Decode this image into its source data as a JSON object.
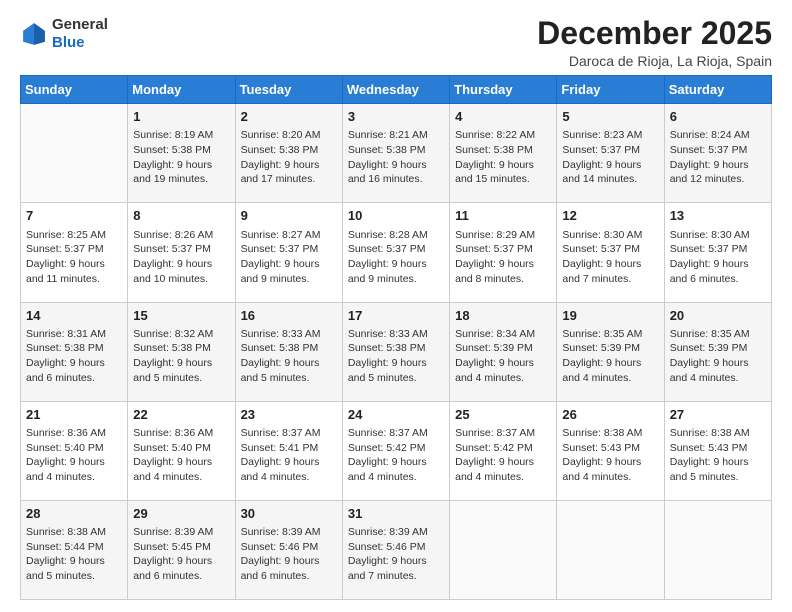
{
  "header": {
    "logo_line1": "General",
    "logo_line2": "Blue",
    "month": "December 2025",
    "location": "Daroca de Rioja, La Rioja, Spain"
  },
  "days_of_week": [
    "Sunday",
    "Monday",
    "Tuesday",
    "Wednesday",
    "Thursday",
    "Friday",
    "Saturday"
  ],
  "weeks": [
    [
      {
        "day": "",
        "info": ""
      },
      {
        "day": "1",
        "info": "Sunrise: 8:19 AM\nSunset: 5:38 PM\nDaylight: 9 hours\nand 19 minutes."
      },
      {
        "day": "2",
        "info": "Sunrise: 8:20 AM\nSunset: 5:38 PM\nDaylight: 9 hours\nand 17 minutes."
      },
      {
        "day": "3",
        "info": "Sunrise: 8:21 AM\nSunset: 5:38 PM\nDaylight: 9 hours\nand 16 minutes."
      },
      {
        "day": "4",
        "info": "Sunrise: 8:22 AM\nSunset: 5:38 PM\nDaylight: 9 hours\nand 15 minutes."
      },
      {
        "day": "5",
        "info": "Sunrise: 8:23 AM\nSunset: 5:37 PM\nDaylight: 9 hours\nand 14 minutes."
      },
      {
        "day": "6",
        "info": "Sunrise: 8:24 AM\nSunset: 5:37 PM\nDaylight: 9 hours\nand 12 minutes."
      }
    ],
    [
      {
        "day": "7",
        "info": "Sunrise: 8:25 AM\nSunset: 5:37 PM\nDaylight: 9 hours\nand 11 minutes."
      },
      {
        "day": "8",
        "info": "Sunrise: 8:26 AM\nSunset: 5:37 PM\nDaylight: 9 hours\nand 10 minutes."
      },
      {
        "day": "9",
        "info": "Sunrise: 8:27 AM\nSunset: 5:37 PM\nDaylight: 9 hours\nand 9 minutes."
      },
      {
        "day": "10",
        "info": "Sunrise: 8:28 AM\nSunset: 5:37 PM\nDaylight: 9 hours\nand 9 minutes."
      },
      {
        "day": "11",
        "info": "Sunrise: 8:29 AM\nSunset: 5:37 PM\nDaylight: 9 hours\nand 8 minutes."
      },
      {
        "day": "12",
        "info": "Sunrise: 8:30 AM\nSunset: 5:37 PM\nDaylight: 9 hours\nand 7 minutes."
      },
      {
        "day": "13",
        "info": "Sunrise: 8:30 AM\nSunset: 5:37 PM\nDaylight: 9 hours\nand 6 minutes."
      }
    ],
    [
      {
        "day": "14",
        "info": "Sunrise: 8:31 AM\nSunset: 5:38 PM\nDaylight: 9 hours\nand 6 minutes."
      },
      {
        "day": "15",
        "info": "Sunrise: 8:32 AM\nSunset: 5:38 PM\nDaylight: 9 hours\nand 5 minutes."
      },
      {
        "day": "16",
        "info": "Sunrise: 8:33 AM\nSunset: 5:38 PM\nDaylight: 9 hours\nand 5 minutes."
      },
      {
        "day": "17",
        "info": "Sunrise: 8:33 AM\nSunset: 5:38 PM\nDaylight: 9 hours\nand 5 minutes."
      },
      {
        "day": "18",
        "info": "Sunrise: 8:34 AM\nSunset: 5:39 PM\nDaylight: 9 hours\nand 4 minutes."
      },
      {
        "day": "19",
        "info": "Sunrise: 8:35 AM\nSunset: 5:39 PM\nDaylight: 9 hours\nand 4 minutes."
      },
      {
        "day": "20",
        "info": "Sunrise: 8:35 AM\nSunset: 5:39 PM\nDaylight: 9 hours\nand 4 minutes."
      }
    ],
    [
      {
        "day": "21",
        "info": "Sunrise: 8:36 AM\nSunset: 5:40 PM\nDaylight: 9 hours\nand 4 minutes."
      },
      {
        "day": "22",
        "info": "Sunrise: 8:36 AM\nSunset: 5:40 PM\nDaylight: 9 hours\nand 4 minutes."
      },
      {
        "day": "23",
        "info": "Sunrise: 8:37 AM\nSunset: 5:41 PM\nDaylight: 9 hours\nand 4 minutes."
      },
      {
        "day": "24",
        "info": "Sunrise: 8:37 AM\nSunset: 5:42 PM\nDaylight: 9 hours\nand 4 minutes."
      },
      {
        "day": "25",
        "info": "Sunrise: 8:37 AM\nSunset: 5:42 PM\nDaylight: 9 hours\nand 4 minutes."
      },
      {
        "day": "26",
        "info": "Sunrise: 8:38 AM\nSunset: 5:43 PM\nDaylight: 9 hours\nand 4 minutes."
      },
      {
        "day": "27",
        "info": "Sunrise: 8:38 AM\nSunset: 5:43 PM\nDaylight: 9 hours\nand 5 minutes."
      }
    ],
    [
      {
        "day": "28",
        "info": "Sunrise: 8:38 AM\nSunset: 5:44 PM\nDaylight: 9 hours\nand 5 minutes."
      },
      {
        "day": "29",
        "info": "Sunrise: 8:39 AM\nSunset: 5:45 PM\nDaylight: 9 hours\nand 6 minutes."
      },
      {
        "day": "30",
        "info": "Sunrise: 8:39 AM\nSunset: 5:46 PM\nDaylight: 9 hours\nand 6 minutes."
      },
      {
        "day": "31",
        "info": "Sunrise: 8:39 AM\nSunset: 5:46 PM\nDaylight: 9 hours\nand 7 minutes."
      },
      {
        "day": "",
        "info": ""
      },
      {
        "day": "",
        "info": ""
      },
      {
        "day": "",
        "info": ""
      }
    ]
  ]
}
